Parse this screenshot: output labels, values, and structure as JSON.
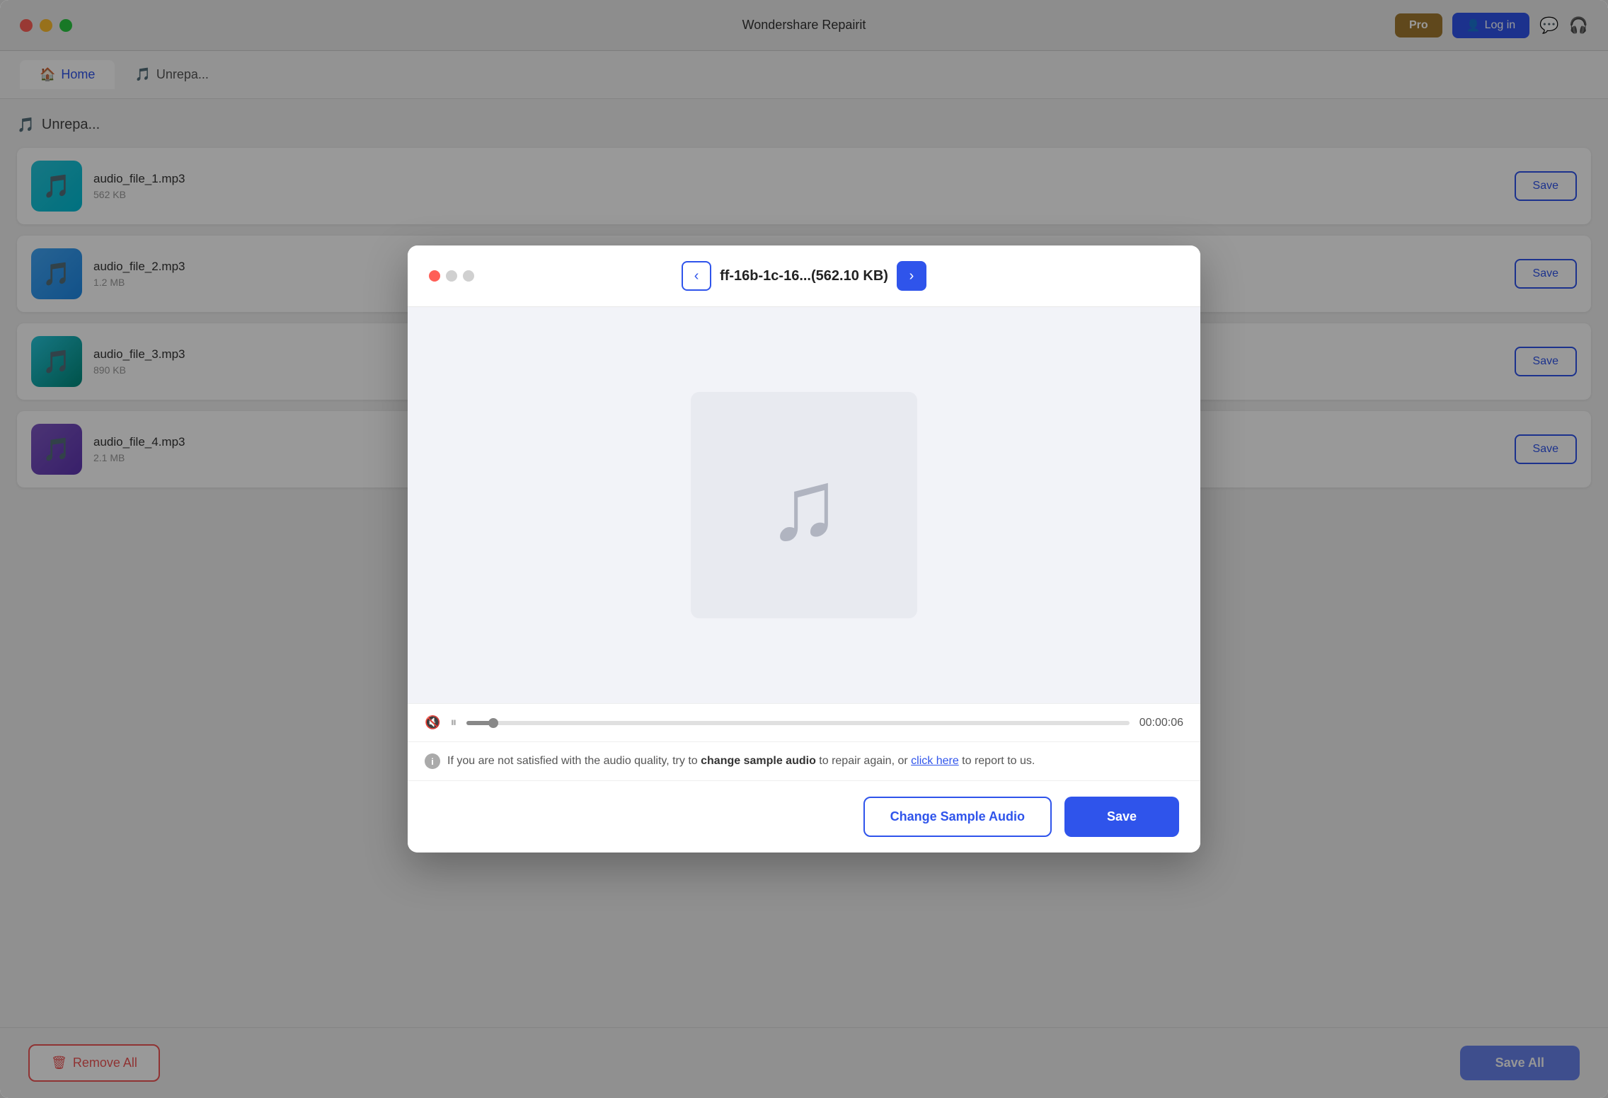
{
  "app": {
    "title": "Wondershare Repairit",
    "pro_label": "Pro",
    "login_label": "Log in"
  },
  "nav": {
    "tabs": [
      {
        "id": "home",
        "label": "Home",
        "active": true
      },
      {
        "id": "unrepairable",
        "label": "Unrepa...",
        "active": false
      }
    ]
  },
  "file_list": {
    "section_title": "Unrepa...",
    "items": [
      {
        "id": 1,
        "name": "audio_file_1.mp3",
        "meta": "562 KB",
        "color": "teal"
      },
      {
        "id": 2,
        "name": "audio_file_2.mp3",
        "meta": "1.2 MB",
        "color": "blue"
      },
      {
        "id": 3,
        "name": "audio_file_3.mp3",
        "meta": "890 KB",
        "color": "green"
      },
      {
        "id": 4,
        "name": "audio_file_4.mp3",
        "meta": "2.1 MB",
        "color": "purple"
      }
    ],
    "save_label": "Save"
  },
  "bottom_bar": {
    "remove_all_label": "Remove All",
    "save_all_label": "Save All"
  },
  "modal": {
    "traffic": {
      "close": "close",
      "minimize": "minimize",
      "maximize": "maximize"
    },
    "prev_label": "‹",
    "next_label": "›",
    "filename": "ff-16b-1c-16...(562.10 KB)",
    "progress_time": "00:00:06",
    "info_text_prefix": "If you are not satisfied with the audio quality, try to ",
    "info_bold": "change sample audio",
    "info_text_middle": " to repair again, or ",
    "info_link": "click here",
    "info_text_suffix": " to report to us.",
    "change_sample_label": "Change Sample Audio",
    "save_label": "Save"
  }
}
